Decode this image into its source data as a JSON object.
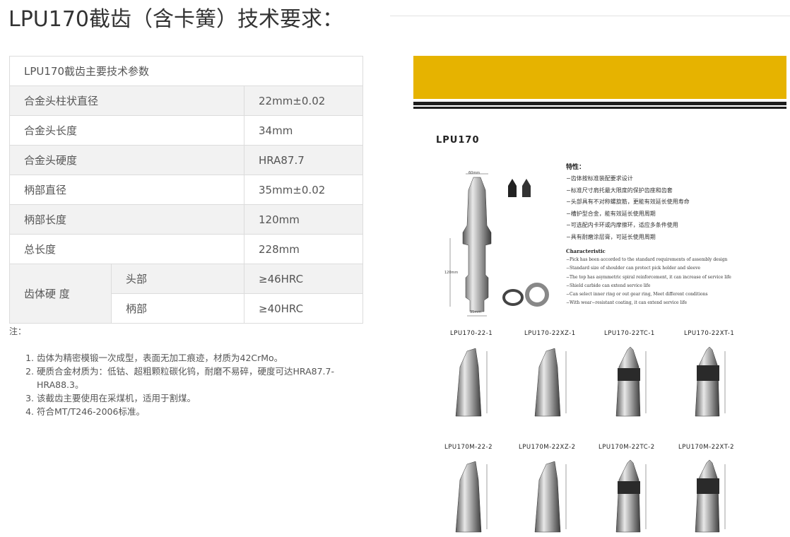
{
  "heading": "LPU170截齿（含卡簧）技术要求：",
  "spec_table": {
    "caption": "LPU170截齿主要技术参数",
    "rows": [
      {
        "name": "合金头柱状直径",
        "value": "22mm±0.02"
      },
      {
        "name": "合金头长度",
        "value": "34mm"
      },
      {
        "name": "合金头硬度",
        "value": "HRA87.7"
      },
      {
        "name": "柄部直径",
        "value": "35mm±0.02"
      },
      {
        "name": "柄部长度",
        "value": "120mm"
      },
      {
        "name": "总长度",
        "value": "228mm"
      }
    ],
    "hardness": {
      "name": "齿体硬 度",
      "rows": [
        {
          "part": "头部",
          "value": "≥46HRC"
        },
        {
          "part": "柄部",
          "value": "≥40HRC"
        }
      ]
    }
  },
  "notes": {
    "label": "注：",
    "items": [
      "齿体为精密模锻一次成型，表面无加工痕迹，材质为42CrMo。",
      "硬质合金材质为：低钴、超粗颗粒碳化钨，耐磨不易碎，硬度可达HRA87.7-HRA88.3。",
      "该截齿主要使用在采煤机，适用于割煤。",
      "符合MT/T246-2006标准。"
    ]
  },
  "catalog": {
    "colors": {
      "band": "#e6b300",
      "stripe": "#1e1e1e"
    },
    "model": "LPU170",
    "features_title": "特性：",
    "features": [
      "−齿体按标准装配要求设计",
      "−标准尺寸肩托最大限度的保护齿座和齿套",
      "−头部具有不对称螺旋筋，更能有效延长使用寿命",
      "−槽护型合金，能有效延长使用周期",
      "−可选配内卡环或内摩擦环，适应多条件使用",
      "−具有耐磨涂层膏，可延长使用周期"
    ],
    "characteristic_title": "Characteristic",
    "characteristics": [
      "−Pick has been accorded to the standard requirements of assembly design",
      "−Standard size of shoulder can protect pick holder and sleeve",
      "−The top has asymmetric spiral reinforcement, it can increase of service life",
      "−Shield carbide can extend service life",
      "−Can select inner ring or out gear ring, Meet different conditions",
      "−With wear−resistant coating, it can extend service life"
    ],
    "dims": {
      "top": "60mm",
      "length": "120mm",
      "shank": "35mm",
      "head_dia": "22mm",
      "head_len": "108mm"
    },
    "variants_row1": [
      "LPU170-22-1",
      "LPU170-22XZ-1",
      "LPU170-22TC-1",
      "LPU170-22XT-1"
    ],
    "variants_row2": [
      "LPU170M-22-2",
      "LPU170M-22XZ-2",
      "LPU170M-22TC-2",
      "LPU170M-22XT-2"
    ]
  }
}
